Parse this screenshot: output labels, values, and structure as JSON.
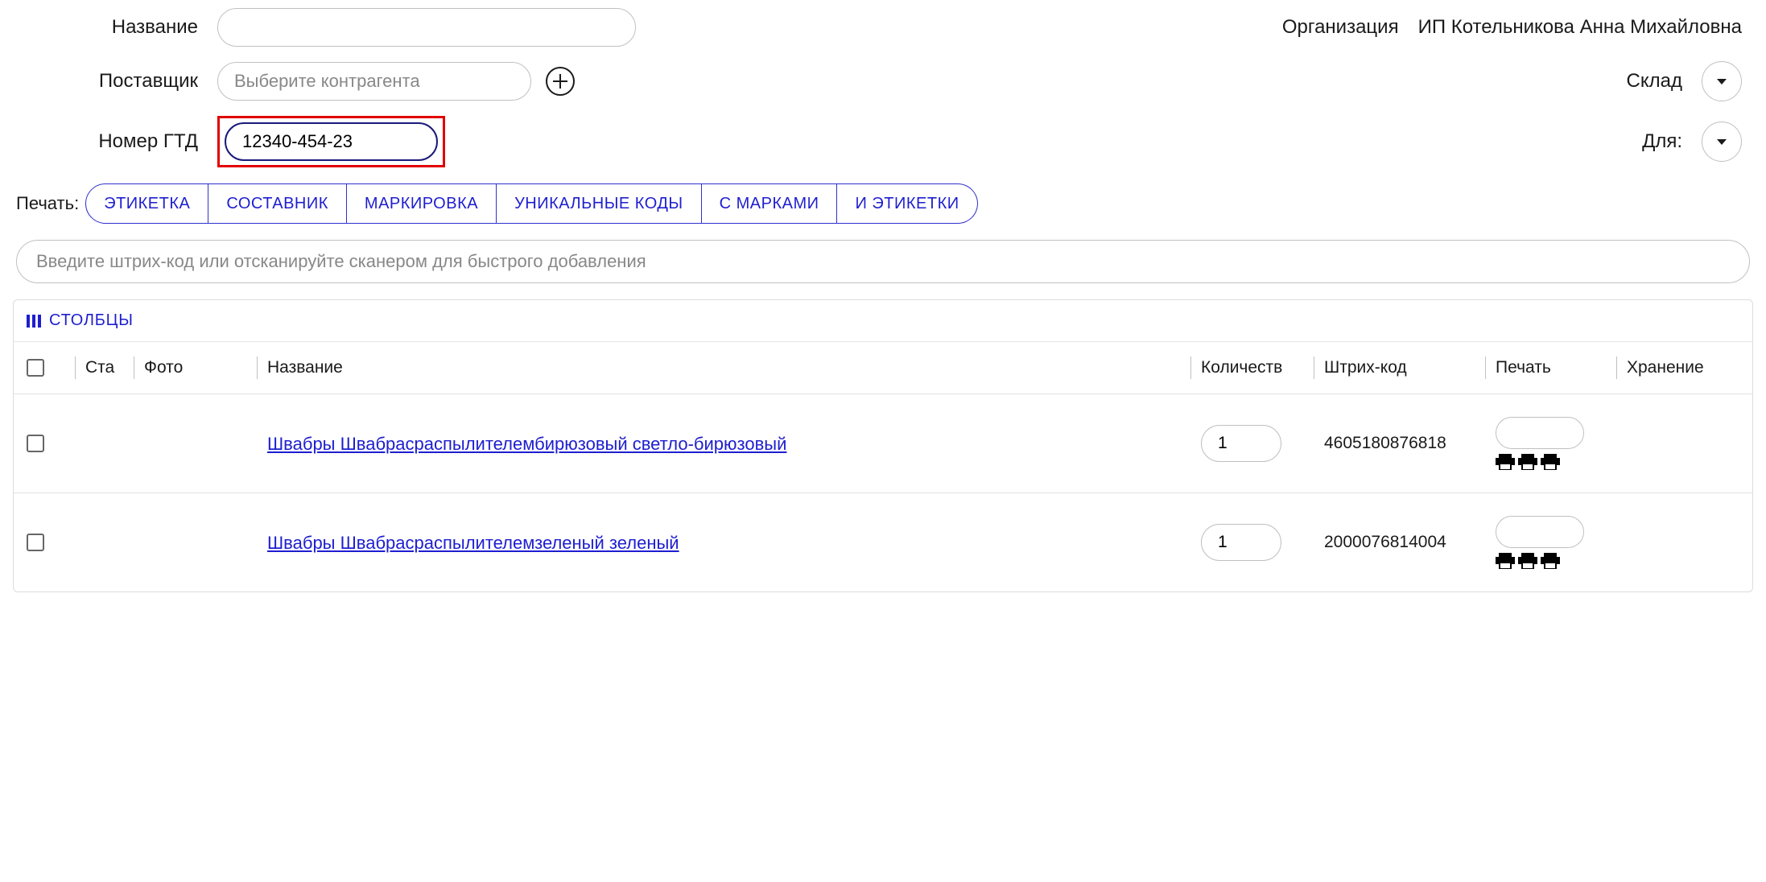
{
  "form": {
    "name_label": "Название",
    "name_value": "",
    "supplier_label": "Поставщик",
    "supplier_placeholder": "Выберите контрагента",
    "gtd_label": "Номер ГТД",
    "gtd_value": "12340-454-23",
    "org_label": "Организация",
    "org_value": "ИП Котельникова Анна Михайловна",
    "warehouse_label": "Склад",
    "for_label": "Для:"
  },
  "print_section": {
    "label": "Печать:",
    "buttons": [
      "ЭТИКЕТКА",
      "СОСТАВНИК",
      "МАРКИРОВКА",
      "УНИКАЛЬНЫЕ КОДЫ",
      "С МАРКАМИ",
      "И ЭТИКЕТКИ"
    ]
  },
  "barcode_placeholder": "Введите штрих-код или отсканируйте сканером для быстрого добавления",
  "columns_btn": "СТОЛБЦЫ",
  "table_headers": {
    "status": "Ста",
    "photo": "Фото",
    "name": "Название",
    "qty": "Количеств",
    "barcode": "Штрих-код",
    "print": "Печать",
    "storage": "Хранение"
  },
  "rows": [
    {
      "name": "Швабры Швабрасраспылителембирюзовый светло-бирюзовый",
      "qty": "1",
      "barcode": "4605180876818"
    },
    {
      "name": "Швабры Швабрасраспылителемзеленый зеленый",
      "qty": "1",
      "barcode": "2000076814004"
    }
  ]
}
